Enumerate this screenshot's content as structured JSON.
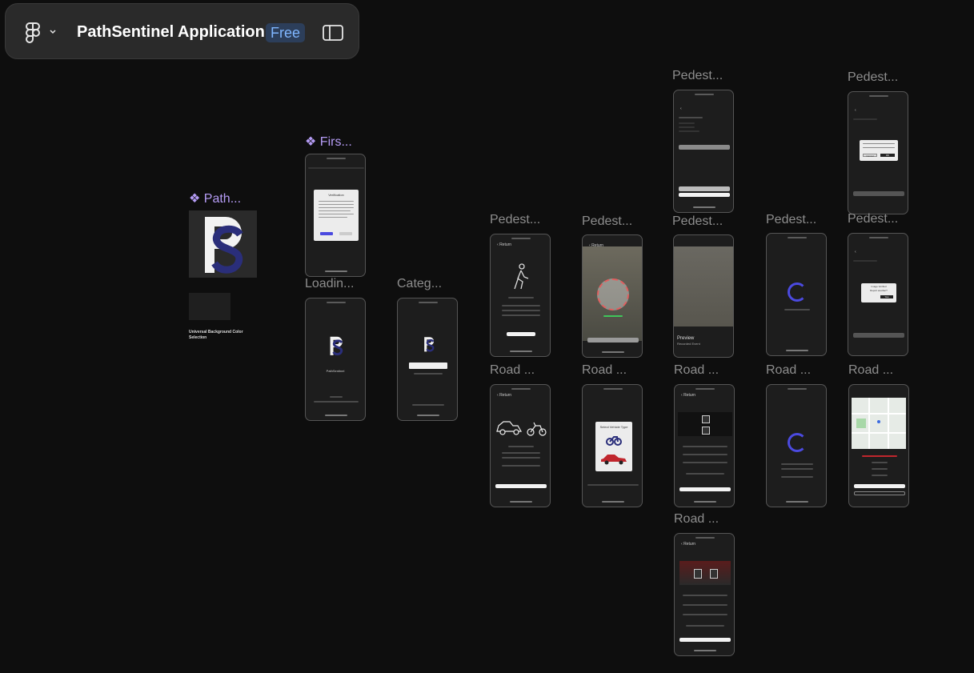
{
  "toolbar": {
    "title": "PathSentinel Application",
    "badge": "Free",
    "figma_menu_icon": "figma-logo-icon",
    "panel_toggle_icon": "sidebar-toggle-icon"
  },
  "colors": {
    "canvas": "#0e0e0e",
    "toolbar": "#2a2a2a",
    "badge_bg": "#2c3e5a",
    "badge_text": "#7fb6ff",
    "component_label": "#b59cf5",
    "frame_label": "#8d8d8d",
    "spinner": "#4b4ae0",
    "logo_navy": "#2a2e7a"
  },
  "components": {
    "logo": "❖ Path...",
    "first_launch": "❖ Firs..."
  },
  "frame_labels": {
    "loading": "Loadin...",
    "category": "Categ...",
    "pedestrian": "Pedest...",
    "road": "Road ..."
  },
  "background_caption": "Universal Background Color Selection",
  "screens": {
    "verification_title": "Verification",
    "app_name": "PathSentinel",
    "return_label": "Return",
    "select_vehicle_title": "Select Vehicle Type",
    "calibrate": "Calibrate",
    "preview_title": "Preview",
    "preview_subtitle": "Recorded Event",
    "verify_title": "Image Verified",
    "report_question": "Report another?",
    "yes": "Yes",
    "cancel": "Cancel",
    "ok": "OK"
  }
}
